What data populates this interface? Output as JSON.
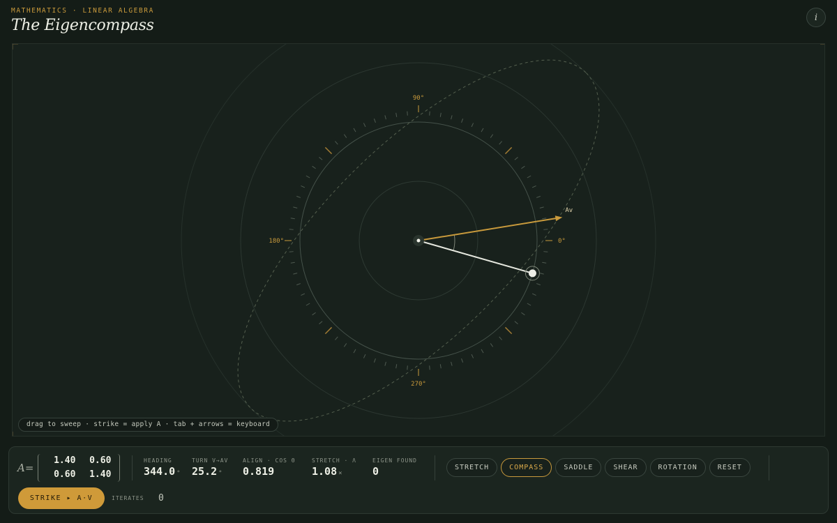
{
  "header": {
    "kicker": "MATHEMATICS · LINEAR ALGEBRA",
    "title": "The Eigencompass",
    "info_icon": "i"
  },
  "compass": {
    "labels": {
      "deg0": "0°",
      "deg90": "90°",
      "deg180": "180°",
      "deg270": "270°",
      "av": "Av"
    },
    "v_heading_deg": 344.0,
    "av_heading_deg": 9.2,
    "colors": {
      "accent": "#c99a3c",
      "vector": "#e6e8df",
      "ring": "#3f4b43"
    }
  },
  "hint": "drag to sweep · strike = apply A · tab + arrows = keyboard",
  "matrix": {
    "label": "A=",
    "a11": "1.40",
    "a12": "0.60",
    "a21": "0.60",
    "a22": "1.40"
  },
  "stats": {
    "heading": {
      "label": "HEADING",
      "value": "344.0",
      "unit": "°"
    },
    "turn": {
      "label": "TURN V→AV",
      "value": "25.2",
      "unit": "°"
    },
    "align": {
      "label": "ALIGN · COS θ",
      "value": "0.819"
    },
    "stretch": {
      "label": "STRETCH · Λ",
      "value": "1.08",
      "unit": "×"
    },
    "eigen": {
      "label": "EIGEN FOUND",
      "value": "0"
    }
  },
  "modes": [
    "STRETCH",
    "COMPASS",
    "SADDLE",
    "SHEAR",
    "ROTATION",
    "RESET"
  ],
  "active_mode": "COMPASS",
  "strike_label": "STRIKE ▸ A·V",
  "iterates": {
    "label": "ITERATES",
    "value": "0"
  }
}
